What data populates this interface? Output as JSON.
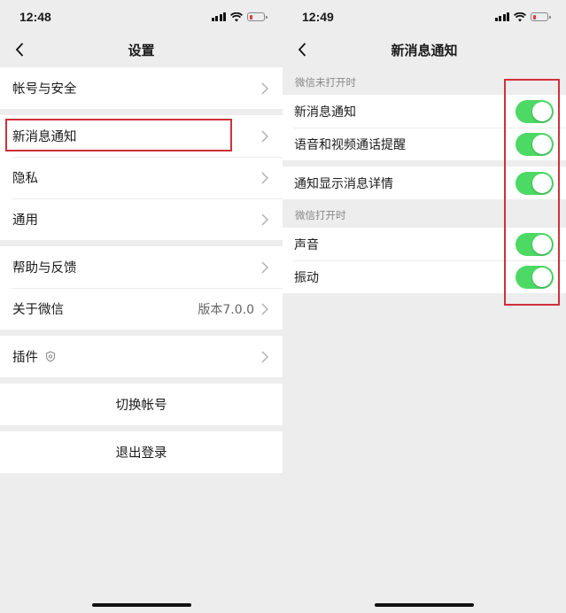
{
  "left": {
    "status": {
      "time": "12:48"
    },
    "nav": {
      "title": "设置"
    },
    "groups": [
      [
        {
          "label": "帐号与安全"
        }
      ],
      [
        {
          "label": "新消息通知"
        },
        {
          "label": "隐私"
        },
        {
          "label": "通用"
        }
      ],
      [
        {
          "label": "帮助与反馈"
        },
        {
          "label": "关于微信",
          "value": "版本7.0.0"
        }
      ],
      [
        {
          "label": "插件"
        }
      ]
    ],
    "switch_account": "切换帐号",
    "logout": "退出登录"
  },
  "right": {
    "status": {
      "time": "12:49"
    },
    "nav": {
      "title": "新消息通知"
    },
    "sections": [
      {
        "header": "微信未打开时",
        "items": [
          {
            "label": "新消息通知",
            "on": true
          },
          {
            "label": "语音和视频通话提醒",
            "on": true
          }
        ]
      },
      {
        "header": "",
        "items": [
          {
            "label": "通知显示消息详情",
            "on": true
          }
        ]
      },
      {
        "header": "微信打开时",
        "items": [
          {
            "label": "声音",
            "on": true
          },
          {
            "label": "振动",
            "on": true
          }
        ]
      }
    ]
  },
  "colors": {
    "toggle_on": "#4cd964",
    "highlight": "#d0303a",
    "background": "#ededed"
  }
}
